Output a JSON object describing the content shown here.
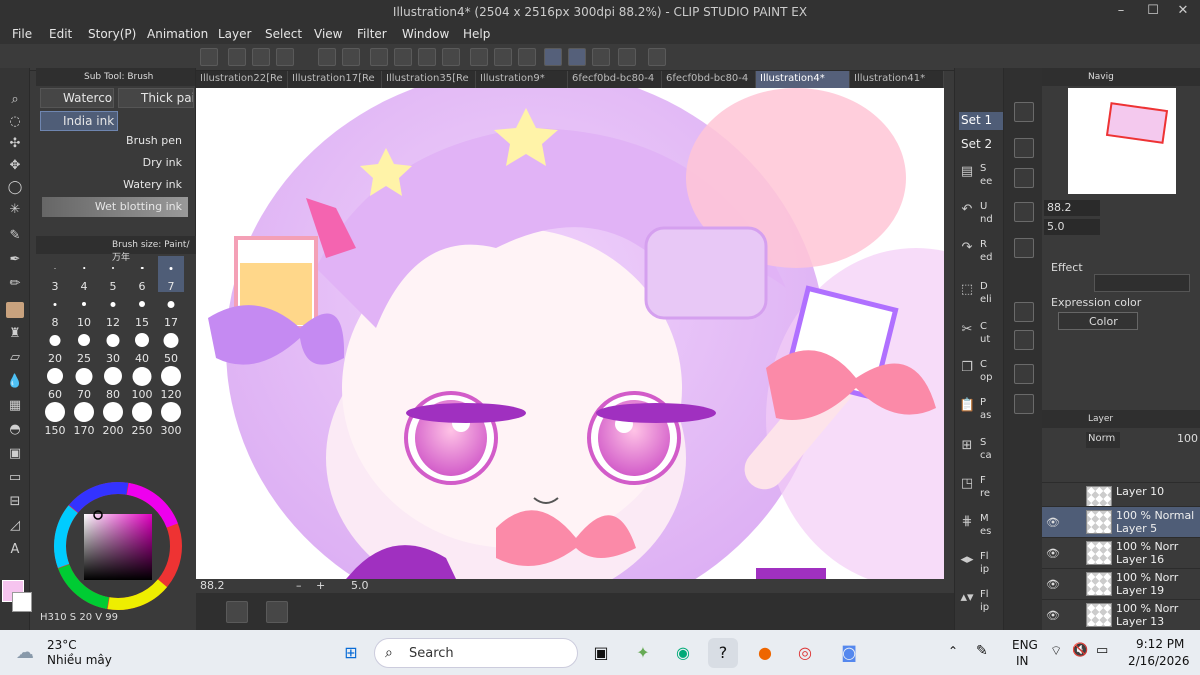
{
  "window": {
    "title": "Illustration4* (2504 x 2516px 300dpi 88.2%)  - CLIP STUDIO PAINT EX",
    "minimize": "–",
    "maximize": "☐",
    "close": "✕"
  },
  "menu": [
    "File",
    "Edit",
    "Story(P)",
    "Animation",
    "Layer",
    "Select",
    "View",
    "Filter",
    "Window",
    "Help"
  ],
  "subtool": {
    "header": "Sub Tool: Brush",
    "tabs": [
      "Watercolor",
      "Thick paint"
    ],
    "selected": "India ink",
    "brushes": [
      "Brush pen",
      "Dry ink",
      "Watery ink",
      "Wet blotting ink"
    ]
  },
  "brushsize": {
    "header": "Brush size: Paint/万年",
    "sizes": [
      "3",
      "4",
      "5",
      "6",
      "7",
      "8",
      "10",
      "12",
      "15",
      "17",
      "20",
      "25",
      "30",
      "40",
      "50",
      "60",
      "70",
      "80",
      "100",
      "120",
      "150",
      "170",
      "200",
      "250",
      "300"
    ]
  },
  "color": {
    "h": "310",
    "s": "20",
    "v": "99",
    "main": "#f6c4ef",
    "sub": "#ffffff"
  },
  "tabs": [
    "Illustration22[Re",
    "Illustration17[Re",
    "Illustration35[Re",
    "Illustration9*",
    "6fecf0bd-bc80-4",
    "6fecf0bd-bc80-4",
    "Illustration4*",
    "Illustration41*"
  ],
  "active_tab": "Illustration4*",
  "status": {
    "zoom": "88.2",
    "angle": "5.0"
  },
  "command_panel": {
    "sets": [
      "Set 1",
      "Set 2"
    ],
    "items": [
      {
        "icon": "new-icon",
        "label": "S\nee"
      },
      {
        "icon": "undo-icon",
        "label": "U\nnd"
      },
      {
        "icon": "redo-icon",
        "label": "R\ned"
      },
      {
        "icon": "deselect-icon",
        "label": "D\neli"
      },
      {
        "icon": "cut-icon",
        "label": "C\nut"
      },
      {
        "icon": "copy-icon",
        "label": "C\nop"
      },
      {
        "icon": "paste-icon",
        "label": "P\nas"
      },
      {
        "icon": "scale-icon",
        "label": "S\nca"
      },
      {
        "icon": "fill-icon",
        "label": "F\nre"
      },
      {
        "icon": "mesh-icon",
        "label": "M\nes"
      },
      {
        "icon": "flip-h-icon",
        "label": "Fl\nip"
      },
      {
        "icon": "flip-v-icon",
        "label": "Fl\nip"
      }
    ]
  },
  "navigator": {
    "header": "Navig",
    "zoom": "88.2",
    "angle": "5.0"
  },
  "properties": {
    "effect_label": "Effect",
    "expression_label": "Expression color",
    "expression_value": "Color"
  },
  "layers": {
    "header": "Layer",
    "blend": "Norm",
    "opacity": "100",
    "rows": [
      {
        "mode": "",
        "name": "Layer 10"
      },
      {
        "mode": "100 % Normal",
        "name": "Layer 5"
      },
      {
        "mode": "100 % Norr",
        "name": "Layer 16"
      },
      {
        "mode": "100 % Norr",
        "name": "Layer 19"
      },
      {
        "mode": "100 % Norr",
        "name": "Layer 13"
      }
    ]
  },
  "taskbar": {
    "weather_temp": "23°C",
    "weather_desc": "Nhiều mây",
    "search": "Search",
    "lang1": "ENG",
    "lang2": "IN",
    "time": "9:12 PM",
    "date": "2/16/2026"
  },
  "colors": {
    "accent": "#4f5d77",
    "canvas_pink": "#f6c4ef"
  }
}
